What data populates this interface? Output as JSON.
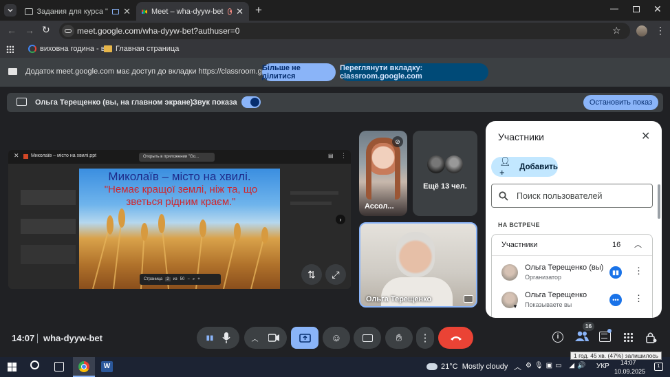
{
  "browser": {
    "tabs": [
      {
        "title": "Задания для курса \"КБ - 1.",
        "active": false
      },
      {
        "title": "Meet – wha-dyyw-bet",
        "active": true
      }
    ],
    "url": "meet.google.com/wha-dyyw-bet?authuser=0",
    "bookmarks": [
      {
        "label": "виховна година - в..."
      },
      {
        "label": "Главная страница"
      }
    ]
  },
  "share_banner": {
    "text": "Додаток meet.google.com має доступ до вкладки https://classroom.google.com",
    "stop_label": "Більше не ділитися",
    "switch_label": "Переглянути вкладку: classroom.google.com"
  },
  "presenting_bar": {
    "title": "Ольга Терещенко (вы, на главном экране)",
    "sound_label": "Звук показа",
    "stop_label": "Остановить показ"
  },
  "shared_content": {
    "doc_title": "Миколаїв – місто на хвилі.ppt",
    "open_with": "Открыть в приложении \"Go...",
    "slide_title": "Миколаїв – місто на хвилі.",
    "slide_quote": "\"Немає кращої землі, ніж та, що зветься рідним краєм.\"",
    "page_label": "Страница",
    "page_current": "2",
    "page_sep": "из",
    "page_total": "50"
  },
  "tiles": {
    "assol": "Ассол...",
    "more": "Ещё 13 чел.",
    "self": "Ольга Терещенко"
  },
  "panel": {
    "title": "Участники",
    "add_label": "Добавить",
    "search_placeholder": "Поиск пользователей",
    "section_label": "НА ВСТРЕЧЕ",
    "group_label": "Участники",
    "group_count": "16",
    "people": [
      {
        "name": "Ольга Терещенко (вы)",
        "role": "Организатор"
      },
      {
        "name": "Ольга Терещенко",
        "role": "Показываете вы"
      }
    ]
  },
  "bottom": {
    "time": "14:07",
    "meeting_code": "wha-dyyw-bet",
    "people_badge": "16"
  },
  "tooltip": "1 год. 45 хв. (47%) залишилось",
  "taskbar": {
    "weather": "21°C  Mostly cloudy",
    "lang": "УКР",
    "time": "14:07",
    "date": "10.09.2025"
  },
  "colors": {
    "accent": "#8ab4f8",
    "end_call": "#ea4335",
    "present_active": "#8ab4f8"
  }
}
